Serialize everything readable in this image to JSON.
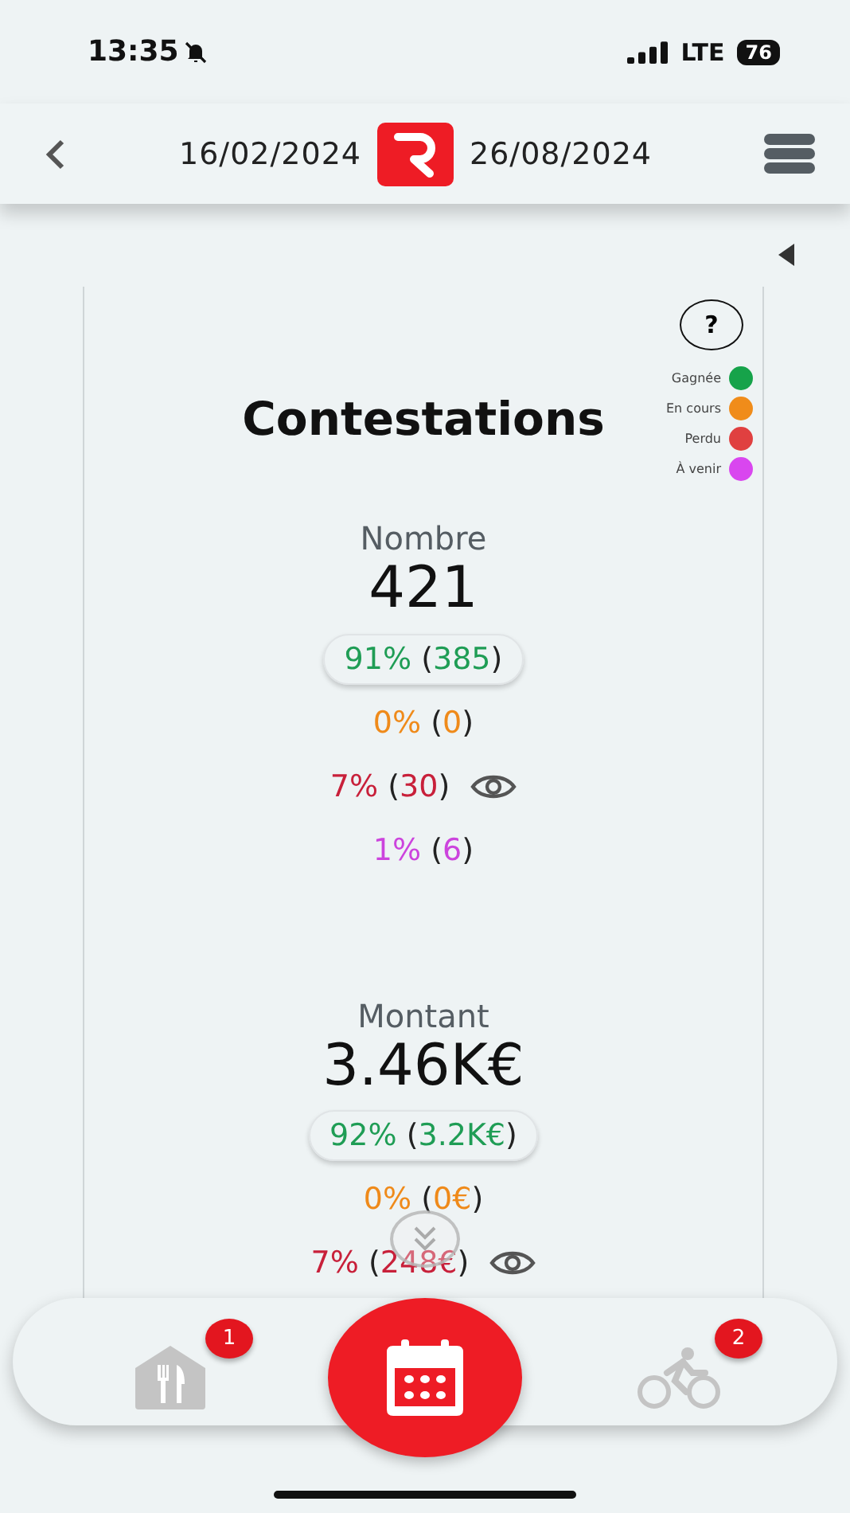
{
  "status_bar": {
    "time": "13:35",
    "network": "LTE",
    "battery": "76"
  },
  "header": {
    "start_date": "16/02/2024",
    "end_date": "26/08/2024"
  },
  "card": {
    "title": "Contestations",
    "help": "?",
    "legend": [
      {
        "label": "Gagnée",
        "color": "#16a34a"
      },
      {
        "label": "En cours",
        "color": "#f08c1a"
      },
      {
        "label": "Perdu",
        "color": "#e04040"
      },
      {
        "label": "À venir",
        "color": "#d946ef"
      }
    ],
    "sections": [
      {
        "label": "Nombre",
        "total": "421",
        "rows": [
          {
            "percent": "91%",
            "count": "(385)",
            "color": "#1f9d55",
            "selected": true,
            "details": false
          },
          {
            "percent": "0%",
            "count": "(0)",
            "color": "#ef8a1a",
            "selected": false,
            "details": false
          },
          {
            "percent": "7%",
            "count": "(30)",
            "color": "#c8203a",
            "selected": false,
            "details": true
          },
          {
            "percent": "1%",
            "count": "(6)",
            "color": "#cc44dd",
            "selected": false,
            "details": false
          }
        ]
      },
      {
        "label": "Montant",
        "total": "3.46K€",
        "rows": [
          {
            "percent": "92%",
            "count": "(3.2K€)",
            "color": "#1f9d55",
            "selected": true,
            "details": false
          },
          {
            "percent": "0%",
            "count": "(0€)",
            "color": "#ef8a1a",
            "selected": false,
            "details": false
          },
          {
            "percent": "7%",
            "count": "(248€)",
            "color": "#c8203a",
            "selected": false,
            "details": true
          }
        ]
      }
    ]
  },
  "nav": [
    {
      "kind": "restaurant",
      "badge": "1",
      "selected": false
    },
    {
      "kind": "calendar",
      "selected": true
    },
    {
      "kind": "bike",
      "badge": "2",
      "selected": false
    }
  ]
}
